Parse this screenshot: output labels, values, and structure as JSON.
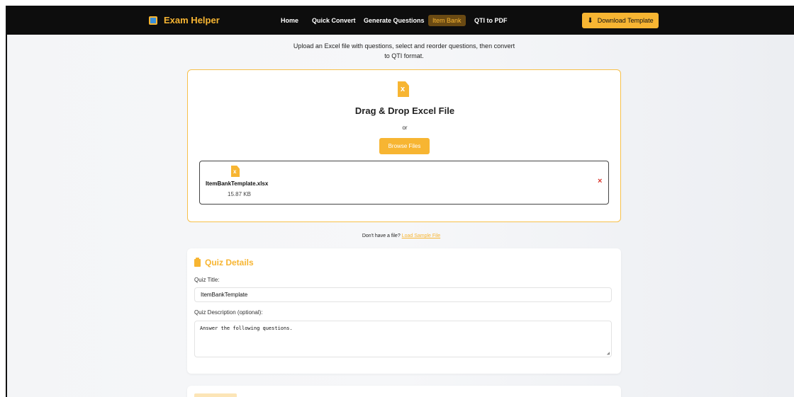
{
  "nav": {
    "brand": "Exam Helper",
    "links": [
      "Home",
      "Quick Convert",
      "Generate Questions",
      "Item Bank",
      "QTI to PDF"
    ],
    "download_button": "Download Template"
  },
  "intro_text": "Upload an Excel file with questions, select and reorder questions, then convert to QTI format.",
  "upload": {
    "title": "Drag & Drop Excel File",
    "or_text": "or",
    "browse_button": "Browse Files",
    "file_name": "ItemBankTemplate.xlsx",
    "file_size": "15.87 KB",
    "remove_icon": "×"
  },
  "sample": {
    "prompt": "Don't have a file?",
    "link": "Load Sample File"
  },
  "quiz_details": {
    "heading": "Quiz Details",
    "title_label": "Quiz Title:",
    "title_value": "ItemBankTemplate",
    "description_label": "Quiz Description (optional):",
    "description_value": "Answer the following questions."
  },
  "colors": {
    "accent": "#f7b532",
    "navbar": "#0d0d0d",
    "active_tab_bg": "#6a4a13",
    "remove": "#d9342b"
  },
  "icons": {
    "brand": "exam-helper-logo",
    "download": "download-icon",
    "excel": "excel-file-icon",
    "remove": "close-icon",
    "quiz": "clipboard-icon"
  }
}
